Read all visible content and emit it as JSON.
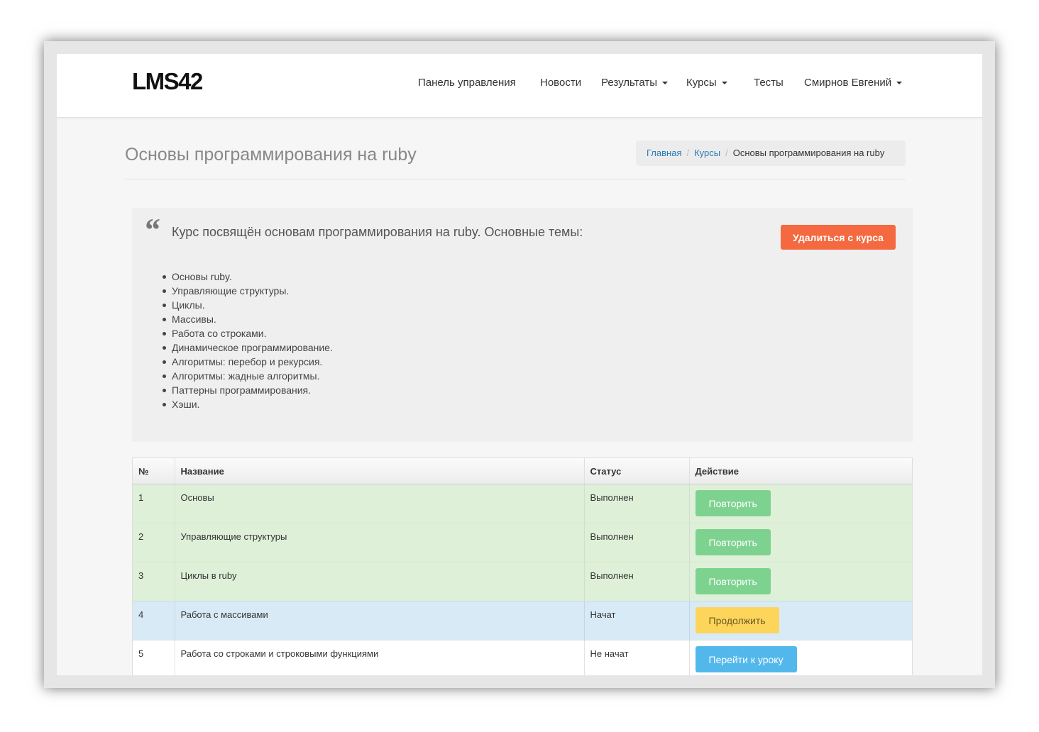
{
  "brand": "LMS42",
  "nav": {
    "dashboard": "Панель управления",
    "news": "Новости",
    "results": "Результаты",
    "courses": "Курсы",
    "tests": "Тесты",
    "user": "Смирнов Евгений"
  },
  "page": {
    "title": "Основы программирования на ruby"
  },
  "breadcrumb": {
    "home": "Главная",
    "courses": "Курсы",
    "current": "Основы программирования на ruby"
  },
  "course": {
    "quote_mark": "“",
    "description": "Курс посвящён основам программирования на ruby. Основные темы:",
    "leave_button": "Удалиться с курса",
    "topics": [
      "Основы ruby.",
      "Управляющие структуры.",
      "Циклы.",
      "Массивы.",
      "Работа со строками.",
      "Динамическое программирование.",
      "Алгоритмы: перебор и рекурсия.",
      "Алгоритмы: жадные алгоритмы.",
      "Паттерны программирования.",
      "Хэши."
    ]
  },
  "table": {
    "headers": [
      "№",
      "Название",
      "Статус",
      "Действие"
    ],
    "rows": [
      {
        "num": "1",
        "name": "Основы",
        "status": "Выполнен",
        "action": "Повторить"
      },
      {
        "num": "2",
        "name": "Управляющие структуры",
        "status": "Выполнен",
        "action": "Повторить"
      },
      {
        "num": "3",
        "name": "Циклы в ruby",
        "status": "Выполнен",
        "action": "Повторить"
      },
      {
        "num": "4",
        "name": "Работа с массивами",
        "status": "Начат",
        "action": "Продолжить"
      },
      {
        "num": "5",
        "name": "Работа со строками и строковыми функциями",
        "status": "Не начат",
        "action": "Перейти к уроку"
      }
    ]
  },
  "colors": {
    "leave_button": "#f4693f",
    "repeat_button": "#7ed290",
    "continue_button": "#fdd55b",
    "go_button": "#52b8ec",
    "done_row": "#dff0d8",
    "started_row": "#d9eaf7",
    "link": "#2a7ab8"
  }
}
